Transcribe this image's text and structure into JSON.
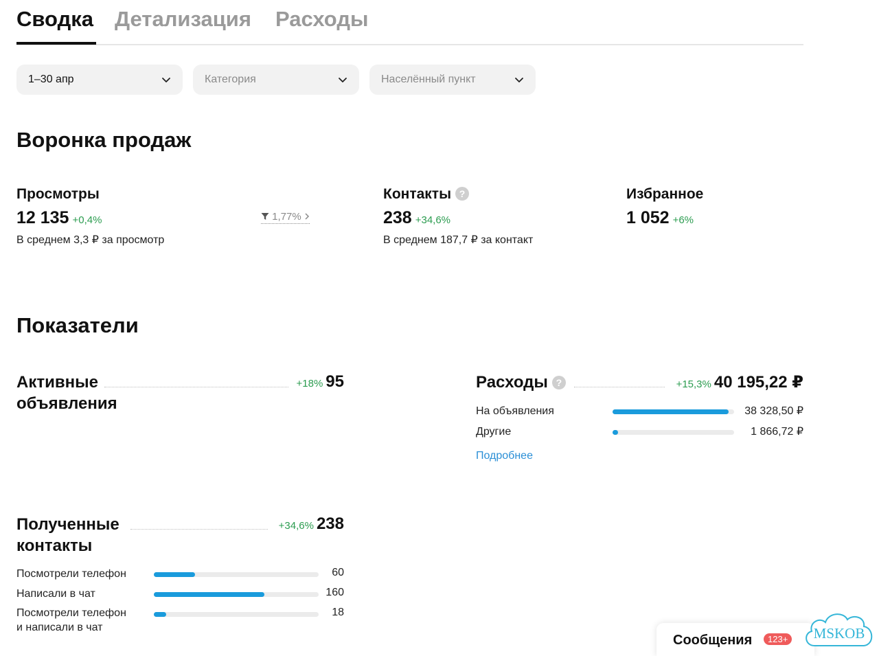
{
  "tabs": [
    "Сводка",
    "Детализация",
    "Расходы"
  ],
  "filters": {
    "period": "1–30 апр",
    "category_placeholder": "Категория",
    "city_placeholder": "Населённый пункт"
  },
  "funnel": {
    "title": "Воронка продаж",
    "views": {
      "label": "Просмотры",
      "value": "12 135",
      "delta": "+0,4%",
      "sub": "В среднем 3,3 ₽ за просмотр",
      "conversion": "1,77%"
    },
    "contacts": {
      "label": "Контакты",
      "value": "238",
      "delta": "+34,6%",
      "sub": "В среднем 187,7 ₽ за контакт"
    },
    "favorites": {
      "label": "Избранное",
      "value": "1 052",
      "delta": "+6%"
    }
  },
  "indicators": {
    "title": "Показатели",
    "active_ads": {
      "line1": "Активные",
      "line2": "объявления",
      "delta": "+18%",
      "value": "95"
    },
    "expenses": {
      "label": "Расходы",
      "delta": "+15,3%",
      "value": "40 195,22 ₽",
      "rows": [
        {
          "label": "На объявления",
          "value": "38 328,50 ₽",
          "fraction": 0.954
        },
        {
          "label": "Другие",
          "value": "1 866,72 ₽",
          "fraction": 0.046
        }
      ],
      "more": "Подробнее"
    },
    "received_contacts": {
      "line1": "Полученные",
      "line2": "контакты",
      "delta": "+34,6%",
      "value": "238",
      "rows": [
        {
          "label": "Посмотрели телефон",
          "value": "60",
          "fraction": 0.252
        },
        {
          "label": "Написали в чат",
          "value": "160",
          "fraction": 0.672
        },
        {
          "label1": "Посмотрели телефон",
          "label2": "и написали в чат",
          "value": "18",
          "fraction": 0.076
        }
      ]
    }
  },
  "messages": {
    "label": "Сообщения",
    "badge": "123+"
  },
  "watermark": "MSKOB",
  "colors": {
    "accent": "#1a9bdc",
    "positive": "#2c9c50",
    "link": "#2b8fd6",
    "badge": "#ef5b5b"
  }
}
